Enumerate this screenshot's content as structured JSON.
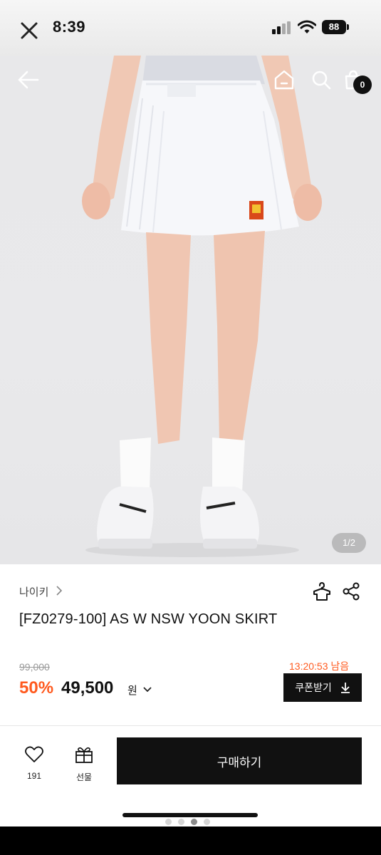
{
  "status_bar": {
    "time": "8:39",
    "battery": "88"
  },
  "hero": {
    "image_counter": "1/2",
    "cart_count": "0"
  },
  "product": {
    "brand": "나이키",
    "title": "[FZ0279-100] AS W NSW YOON SKIRT",
    "original_price": "99,000",
    "discount": "50%",
    "sale_price": "49,500",
    "currency": "원",
    "countdown": "13:20:53 남음",
    "coupon_label": "쿠폰받기"
  },
  "bottom_bar": {
    "like_count": "191",
    "gift_label": "선물",
    "buy_label": "구매하기"
  },
  "colors": {
    "accent": "#ff5a1f",
    "primary": "#111111",
    "muted": "#999999"
  },
  "icons": [
    "close-icon",
    "cellular-signal-icon",
    "wifi-icon",
    "battery-icon",
    "back-arrow-icon",
    "home-icon",
    "search-icon",
    "shopping-bag-icon",
    "chevron-right-icon",
    "hanger-icon",
    "share-icon",
    "chevron-down-icon",
    "download-icon",
    "heart-icon",
    "gift-icon"
  ]
}
